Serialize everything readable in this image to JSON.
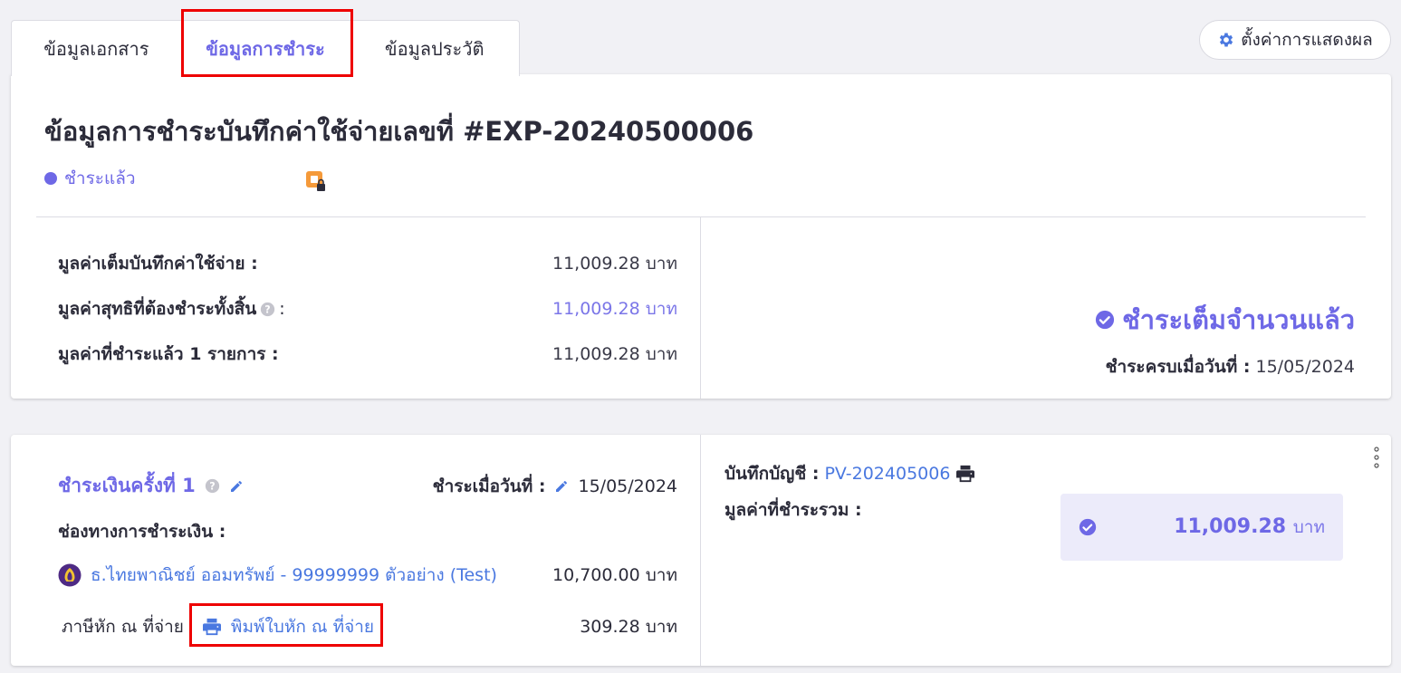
{
  "tabs": [
    "ข้อมูลเอกสาร",
    "ข้อมูลการชำระ",
    "ข้อมูลประวัติ"
  ],
  "settings_label": "ตั้งค่าการแสดงผล",
  "summary": {
    "title": "ข้อมูลการชำระบันทึกค่าใช้จ่ายเลขที่ #EXP-20240500006",
    "status": "ชำระแล้ว",
    "rows": [
      {
        "label": "มูลค่าเต็มบันทึกค่าใช้จ่าย :",
        "value": "11,009.28 บาท"
      },
      {
        "label": "มูลค่าสุทธิที่ต้องชำระทั้งสิ้น",
        "suffix": ":",
        "value": "11,009.28 บาท"
      },
      {
        "label": "มูลค่าที่ชำระแล้ว 1 รายการ :",
        "value": "11,009.28 บาท"
      }
    ],
    "full_paid_label": "ชำระเต็มจำนวนแล้ว",
    "paid_date_label": "ชำระครบเมื่อวันที่ :",
    "paid_date": "15/05/2024"
  },
  "payment": {
    "title": "ชำระเงินครั้งที่ 1",
    "date_label": "ชำระเมื่อวันที่ :",
    "date": "15/05/2024",
    "channel_label": "ช่องทางการชำระเงิน :",
    "bank": "ธ.ไทยพาณิชย์ ออมทรัพย์ - 99999999 ตัวอย่าง (Test)",
    "bank_amount": "10,700.00 บาท",
    "wht_label": "ภาษีหัก ณ ที่จ่าย",
    "print_wht": "พิมพ์ใบหัก ณ ที่จ่าย",
    "wht_amount": "309.28 บาท",
    "account_label": "บันทึกบัญชี :",
    "account_no": "PV-202405006",
    "total_label": "มูลค่าที่ชำระรวม :",
    "total_amount": "11,009.28",
    "total_unit": "บาท"
  },
  "colors": {
    "accent": "#6e68e6",
    "link": "#4a78e0",
    "highlight": "#e00000"
  }
}
